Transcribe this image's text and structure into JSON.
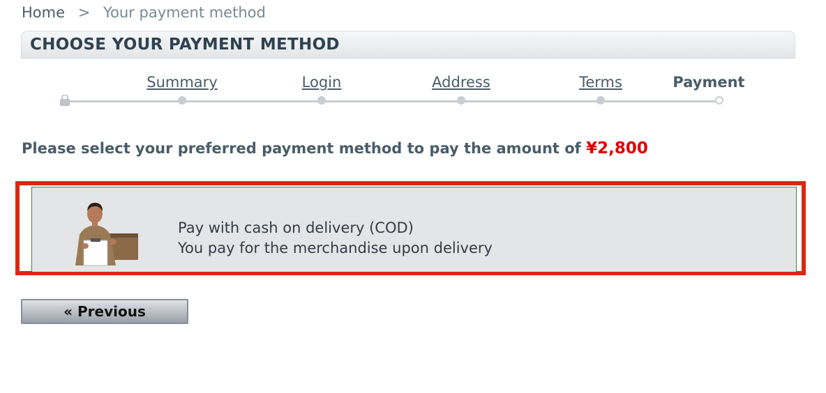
{
  "breadcrumb": {
    "home": "Home",
    "separator": ">",
    "current": "Your payment method"
  },
  "heading": {
    "title": "CHOOSE YOUR PAYMENT METHOD"
  },
  "steps": [
    {
      "label": "Summary",
      "state": "done"
    },
    {
      "label": "Login",
      "state": "done"
    },
    {
      "label": "Address",
      "state": "done"
    },
    {
      "label": "Terms",
      "state": "done"
    },
    {
      "label": "Payment",
      "state": "current"
    }
  ],
  "intro": {
    "text": "Please select your preferred payment method to pay the amount of ",
    "amount": "¥2,800"
  },
  "payment_options": [
    {
      "line1": "Pay with cash on delivery (COD)",
      "line2": "You pay for the merchandise upon delivery",
      "icon": "courier-delivery-image"
    }
  ],
  "buttons": {
    "previous": "« Previous"
  },
  "colors": {
    "amount": "#e00000",
    "highlight_border": "#d92811",
    "option_border": "#3a8a3a",
    "text": "#4a5c68"
  }
}
